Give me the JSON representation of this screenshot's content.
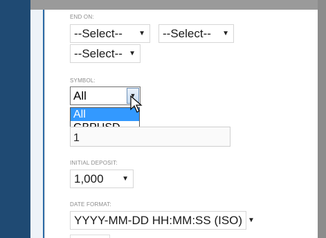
{
  "end_on": {
    "label": "END ON:",
    "select_1": "--Select--",
    "select_2": "--Select--",
    "select_3": "--Select--"
  },
  "symbol": {
    "label": "SYMBOL:",
    "selected": "All",
    "options": [
      "All",
      "GBPUSD"
    ],
    "highlighted_option": "All"
  },
  "hidden_field": {
    "value": "1"
  },
  "initial_deposit": {
    "label": "INITIAL DEPOSIT:",
    "value": "1,000"
  },
  "date_format": {
    "label": "DATE FORMAT:",
    "value": "YYYY-MM-DD HH:MM:SS (ISO)"
  },
  "icons": {
    "dropdown": "chevron-down-icon",
    "cursor": "mouse-pointer-icon"
  },
  "colors": {
    "left_bar": "#1f4a73",
    "highlight": "#3399ff"
  }
}
